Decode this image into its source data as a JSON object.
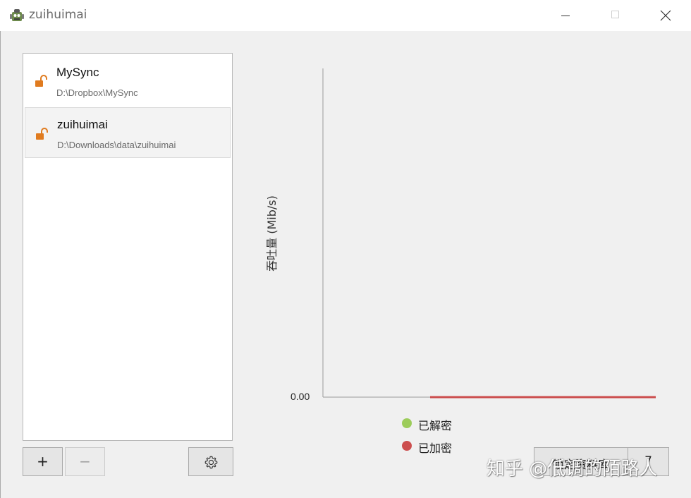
{
  "window": {
    "title": "zuihuimai",
    "icon": "robot-app-icon"
  },
  "vaults": [
    {
      "name": "MySync",
      "path": "D:\\Dropbox\\MySync",
      "icon": "unlocked-padlock-icon",
      "selected": false
    },
    {
      "name": "zuihuimai",
      "path": "D:\\Downloads\\data\\zuihuimai",
      "icon": "unlocked-padlock-icon",
      "selected": true
    }
  ],
  "toolbar": {
    "add_label": "+",
    "remove_label": "−",
    "settings_icon": "gear-icon"
  },
  "chart_data": {
    "type": "line",
    "ylabel": "吞吐量 (Mib/s)",
    "xlabel": "",
    "y_ticks": [
      "0.00"
    ],
    "ylim": [
      0,
      1
    ],
    "grid": false,
    "legend_position": "bottom-center",
    "series": [
      {
        "name": "已解密",
        "color": "#9ccc5a",
        "values": []
      },
      {
        "name": "已加密",
        "color": "#cc4e4e",
        "values": [
          0,
          0
        ]
      }
    ],
    "encrypted_series_x_range": [
      "start-of-recent-window",
      "now"
    ]
  },
  "actions": {
    "lock_label": "锁定资料库",
    "lock_menu_label": "7"
  },
  "watermark": "知乎 @低调的陌路人",
  "colors": {
    "lock_orange": "#e07b1f",
    "decrypted_green": "#9ccc5a",
    "encrypted_red": "#cc4e4e"
  }
}
